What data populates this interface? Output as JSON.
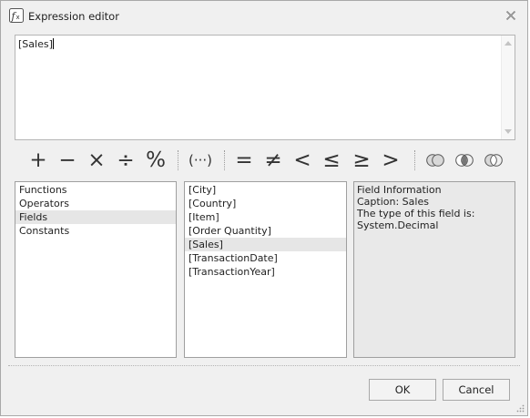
{
  "window": {
    "title": "Expression editor",
    "icon": "function-icon",
    "close_icon": "close-icon"
  },
  "editor": {
    "value": "[Sales]"
  },
  "operators": {
    "arithmetic": [
      "+",
      "−",
      "×",
      "÷",
      "%"
    ],
    "grouping": "(···)",
    "comparison": [
      "=",
      "≠",
      "<",
      "≤",
      "≥",
      ">"
    ],
    "set_icons": [
      "venn-union-icon",
      "venn-intersect-icon",
      "venn-difference-icon"
    ]
  },
  "categories": {
    "items": [
      "Functions",
      "Operators",
      "Fields",
      "Constants"
    ],
    "selected": "Fields"
  },
  "fields": {
    "items": [
      "[City]",
      "[Country]",
      "[Item]",
      "[Order Quantity]",
      "[Sales]",
      "[TransactionDate]",
      "[TransactionYear]"
    ],
    "selected": "[Sales]"
  },
  "info": {
    "lines": [
      "Field Information",
      "Caption: Sales",
      "The type of this field is:",
      "System.Decimal"
    ]
  },
  "buttons": {
    "ok": "OK",
    "cancel": "Cancel"
  }
}
